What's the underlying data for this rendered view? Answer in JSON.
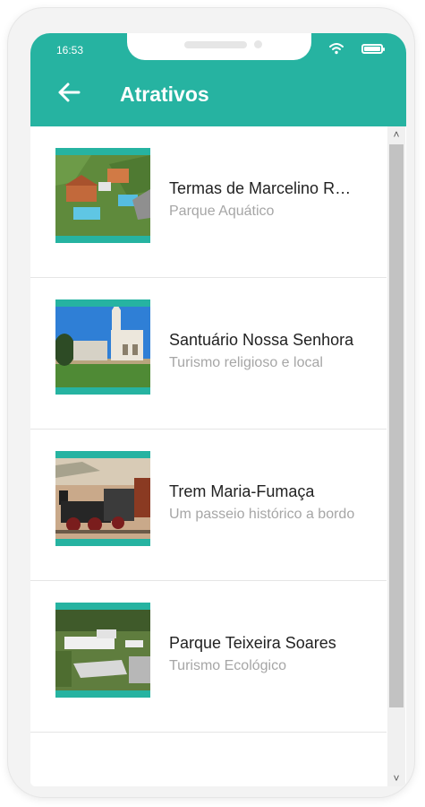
{
  "status_bar": {
    "time": "16:53"
  },
  "app_bar": {
    "title": "Atrativos"
  },
  "attractions": [
    {
      "name": "Termas de Marcelino Ramos",
      "description": "Parque Aquático"
    },
    {
      "name": "Santuário Nossa Senhora",
      "description": "Turismo religioso e local"
    },
    {
      "name": "Trem Maria-Fumaça",
      "description": "Um passeio histórico a bordo"
    },
    {
      "name": "Parque Teixeira Soares",
      "description": "Turismo Ecológico"
    }
  ],
  "scrollbar": {
    "up_glyph": "˄",
    "down_glyph": "˅"
  },
  "colors": {
    "accent": "#26b3a1",
    "title_text": "#222222",
    "subtitle_text": "#a6a6a6"
  },
  "icons": {
    "back": "arrow-left-icon",
    "wifi": "wifi-icon",
    "battery": "battery-icon"
  }
}
